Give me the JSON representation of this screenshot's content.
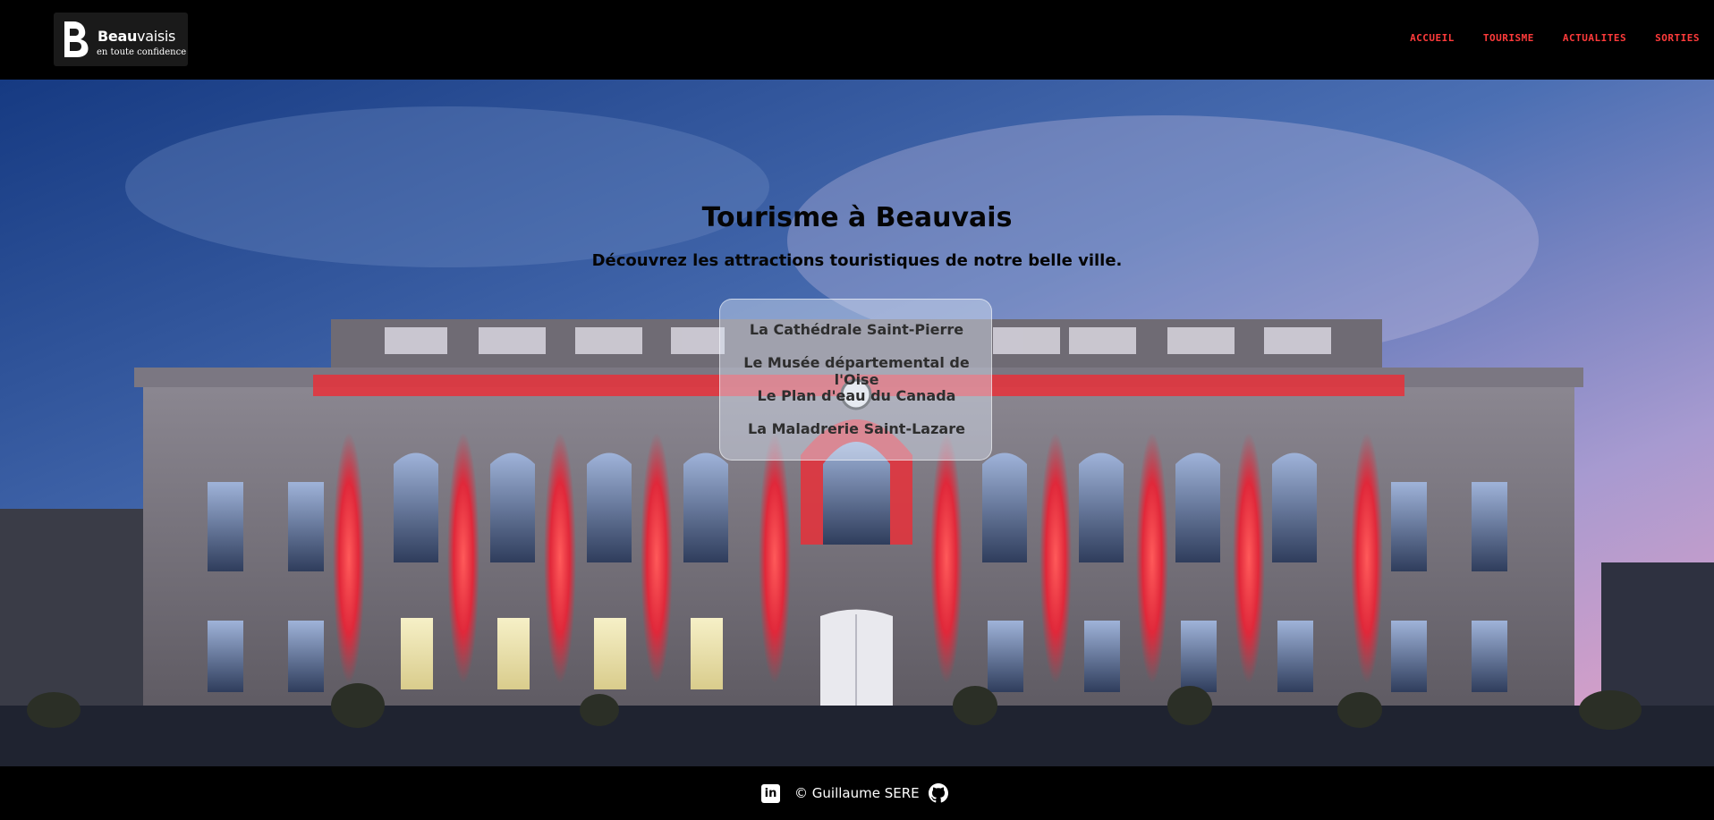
{
  "header": {
    "logo": {
      "name_bold": "Beau",
      "name_rest": "vaisis",
      "tagline": "en toute confidence"
    },
    "nav": [
      {
        "label": "ACCUEIL"
      },
      {
        "label": "TOURISME"
      },
      {
        "label": "ACTUALITES"
      },
      {
        "label": "SORTIES"
      }
    ],
    "nav_color": "#ff3b3b"
  },
  "hero": {
    "title": "Tourisme à Beauvais",
    "subtitle": "Découvrez les attractions touristiques de notre belle ville.",
    "attractions": [
      {
        "label": "La Cathédrale Saint-Pierre"
      },
      {
        "label": "Le Musée départemental de l'Oise"
      },
      {
        "label": "Le Plan d'eau du Canada"
      },
      {
        "label": "La Maladrerie Saint-Lazare"
      }
    ]
  },
  "footer": {
    "copyright": "© Guillaume SERE",
    "linkedin_icon": "linkedin-icon",
    "github_icon": "github-icon"
  },
  "colors": {
    "background": "#000000",
    "accent": "#ff3b3b",
    "facade_light": "#e8303a"
  }
}
